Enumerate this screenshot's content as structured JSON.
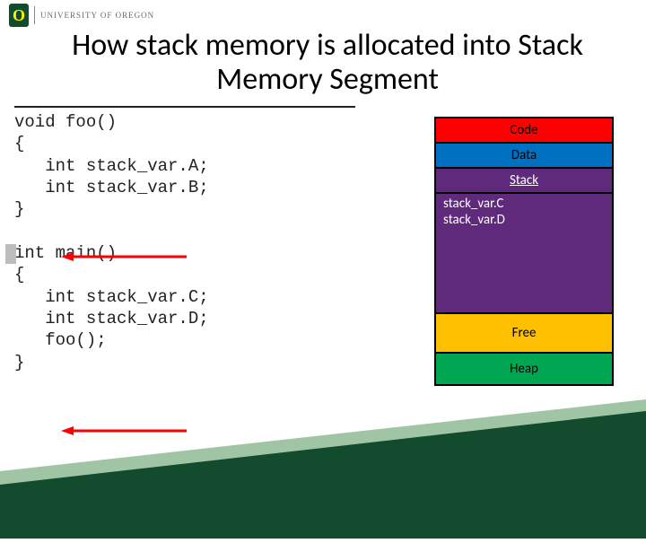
{
  "brand": {
    "university": "UNIVERSITY OF OREGON"
  },
  "title": "How stack memory is allocated into Stack Memory Segment",
  "code": {
    "text": "void foo()\n{\n   int stack_var.A;\n   int stack_var.B;\n}\n\nint main()\n{\n   int stack_var.C;\n   int stack_var.D;\n   foo();\n}"
  },
  "memory": {
    "code": "Code",
    "data": "Data",
    "stack_header": "Stack",
    "stack_frame_1": "stack_var.C",
    "stack_frame_2": "stack_var.D",
    "free": "Free",
    "heap": "Heap"
  },
  "colors": {
    "brand_green": "#134b2f",
    "code": "#ff0000",
    "data": "#0070c0",
    "stack": "#5f2a7b",
    "free": "#ffc000",
    "heap": "#00a651",
    "arrow": "#ff0000"
  }
}
